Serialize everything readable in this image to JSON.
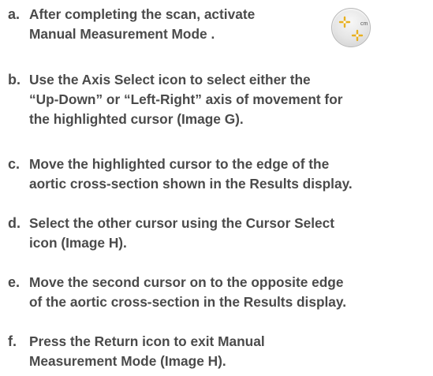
{
  "steps": [
    {
      "letter": "a.",
      "lines": [
        "After completing the scan, activate",
        "Manual Measurement Mode ."
      ]
    },
    {
      "letter": "b.",
      "lines": [
        "Use the Axis Select icon to select either the",
        "“Up-Down” or “Left-Right” axis of movement for",
        "the highlighted cursor (Image G)."
      ]
    },
    {
      "letter": "c.",
      "lines": [
        "Move the highlighted cursor to the edge of the",
        "aortic cross-section shown in the Results display."
      ]
    },
    {
      "letter": "d.",
      "lines": [
        "Select the other cursor using the Cursor Select",
        "icon (Image H)."
      ]
    },
    {
      "letter": "e.",
      "lines": [
        "Move the second cursor on to the opposite edge",
        "of the aortic cross-section in the Results display."
      ]
    },
    {
      "letter": "f.",
      "lines": [
        "Press the Return icon to exit Manual",
        "Measurement Mode (Image H)."
      ]
    }
  ],
  "manual_measurement_icon": {
    "icon": "manual-measurement-mode-icon",
    "label": "cm",
    "accent": "#e8b020"
  }
}
